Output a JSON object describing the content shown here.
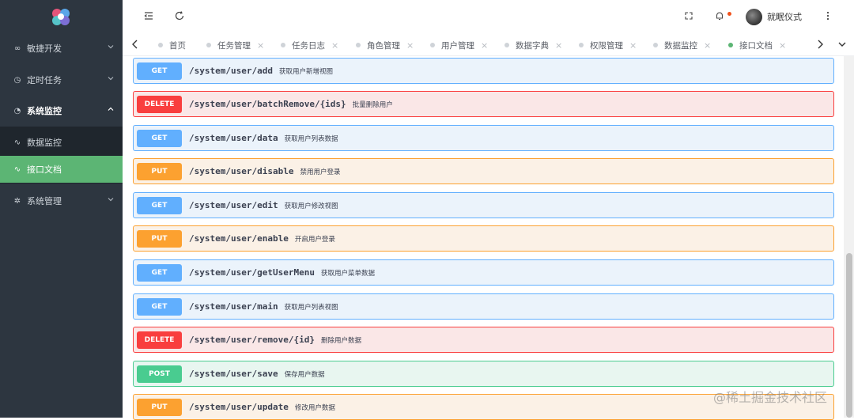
{
  "sidebar": {
    "items": [
      {
        "label": "敏捷开发",
        "icon": "link-icon"
      },
      {
        "label": "定时任务",
        "icon": "clock-icon"
      },
      {
        "label": "系统监控",
        "icon": "dashboard-icon"
      },
      {
        "label": "数据监控",
        "icon": "pulse-icon"
      },
      {
        "label": "接口文档",
        "icon": "pulse-icon"
      },
      {
        "label": "系统管理",
        "icon": "gear-icon"
      }
    ]
  },
  "header": {
    "username": "就眠仪式"
  },
  "tabs": [
    {
      "label": "首页"
    },
    {
      "label": "任务管理"
    },
    {
      "label": "任务日志"
    },
    {
      "label": "角色管理"
    },
    {
      "label": "用户管理"
    },
    {
      "label": "数据字典"
    },
    {
      "label": "权限管理"
    },
    {
      "label": "数据监控"
    },
    {
      "label": "接口文档"
    }
  ],
  "operations": [
    {
      "method": "GET",
      "path": "/system/user/add",
      "desc": "获取用户新增视图"
    },
    {
      "method": "DELETE",
      "path": "/system/user/batchRemove/{ids}",
      "desc": "批量删除用户"
    },
    {
      "method": "GET",
      "path": "/system/user/data",
      "desc": "获取用户列表数据"
    },
    {
      "method": "PUT",
      "path": "/system/user/disable",
      "desc": "禁用用户登录"
    },
    {
      "method": "GET",
      "path": "/system/user/edit",
      "desc": "获取用户修改视图"
    },
    {
      "method": "PUT",
      "path": "/system/user/enable",
      "desc": "开启用户登录"
    },
    {
      "method": "GET",
      "path": "/system/user/getUserMenu",
      "desc": "获取用户菜单数据"
    },
    {
      "method": "GET",
      "path": "/system/user/main",
      "desc": "获取用户列表视图"
    },
    {
      "method": "DELETE",
      "path": "/system/user/remove/{id}",
      "desc": "删除用户数据"
    },
    {
      "method": "POST",
      "path": "/system/user/save",
      "desc": "保存用户数据"
    },
    {
      "method": "PUT",
      "path": "/system/user/update",
      "desc": "修改用户数据"
    }
  ],
  "watermark": "@稀土掘金技术社区",
  "colors": {
    "sidebar_bg": "#2d3640",
    "active_green": "#5cb574",
    "get": "#61affe",
    "delete": "#f93e3e",
    "put": "#fca130",
    "post": "#49cc90"
  }
}
